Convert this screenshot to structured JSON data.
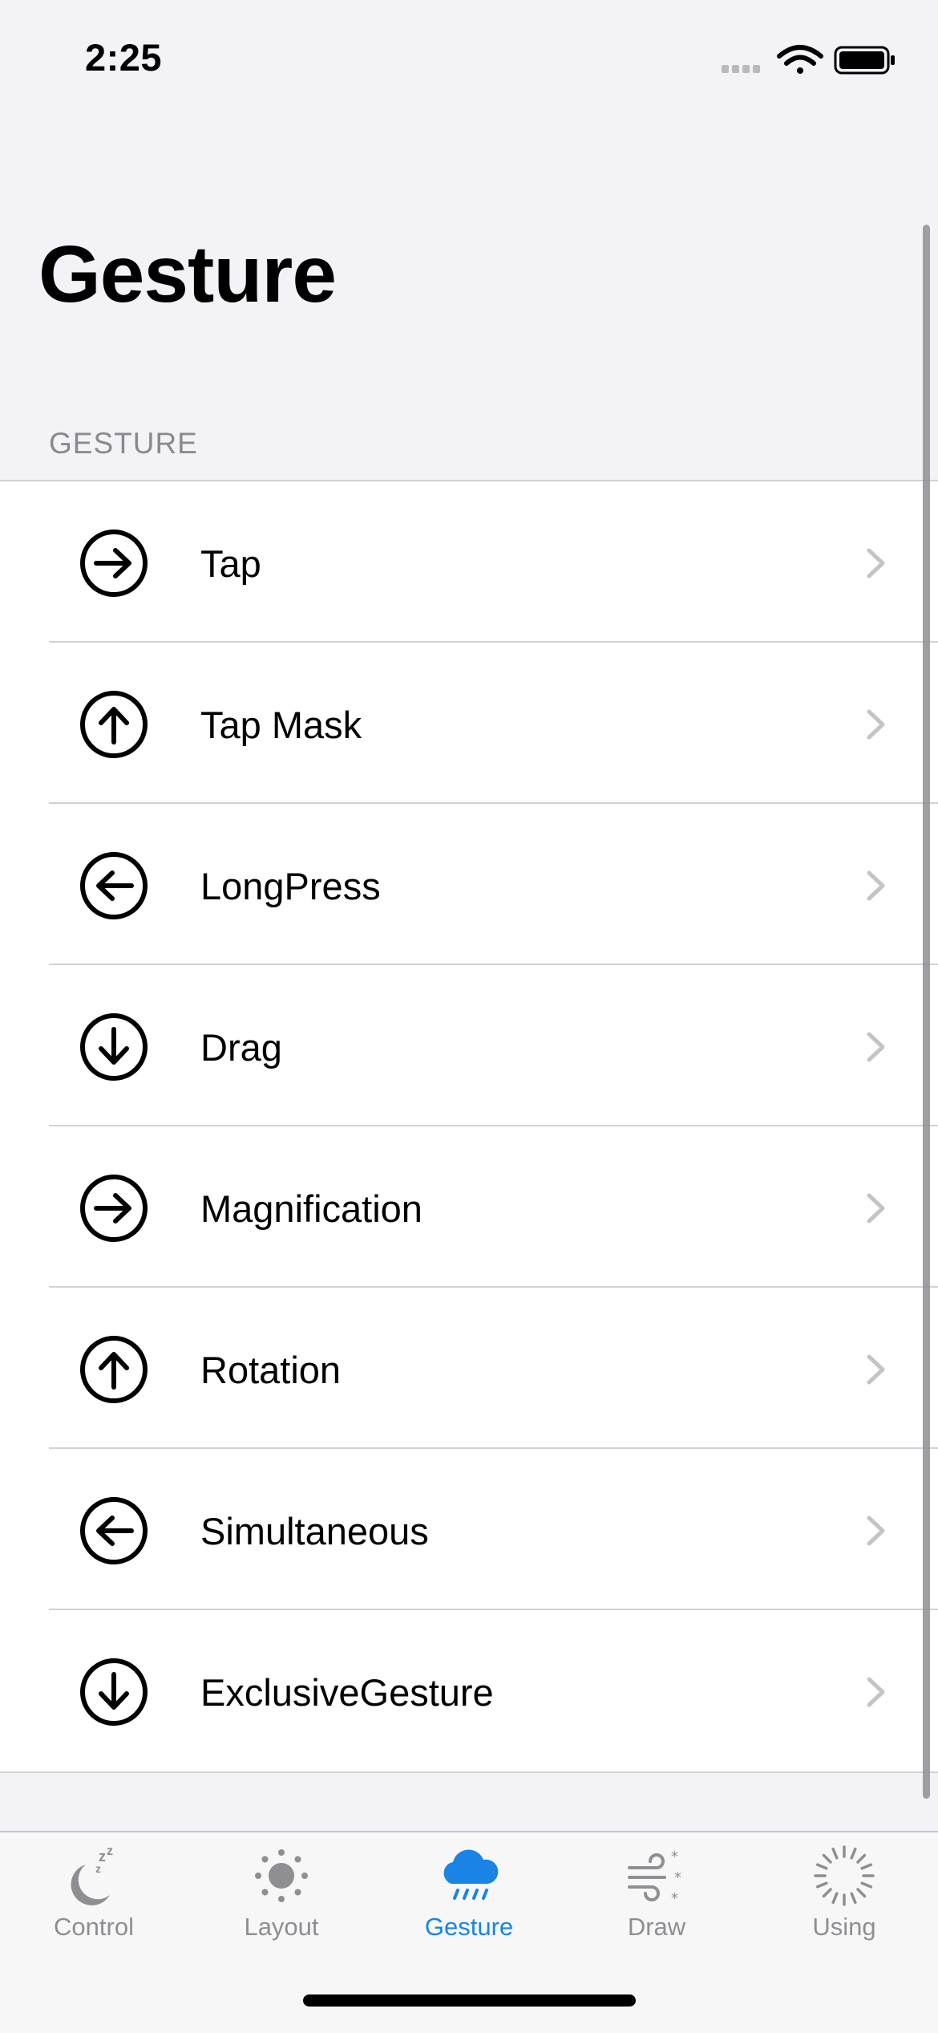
{
  "status_bar": {
    "time": "2:25",
    "icons": [
      "signal-icon",
      "wifi-icon",
      "battery-icon"
    ]
  },
  "nav": {
    "title": "Gesture"
  },
  "section": {
    "header": "GESTURE"
  },
  "rows": [
    {
      "label": "Tap",
      "icon": "arrow-right-circle-icon"
    },
    {
      "label": "Tap Mask",
      "icon": "arrow-up-circle-icon"
    },
    {
      "label": "LongPress",
      "icon": "arrow-left-circle-icon"
    },
    {
      "label": "Drag",
      "icon": "arrow-down-circle-icon"
    },
    {
      "label": "Magnification",
      "icon": "arrow-right-circle-icon"
    },
    {
      "label": "Rotation",
      "icon": "arrow-up-circle-icon"
    },
    {
      "label": "Simultaneous",
      "icon": "arrow-left-circle-icon"
    },
    {
      "label": "ExclusiveGesture",
      "icon": "arrow-down-circle-icon"
    }
  ],
  "tabs": [
    {
      "label": "Control",
      "icon": "moon-zzz-icon",
      "active": false
    },
    {
      "label": "Layout",
      "icon": "sun-icon",
      "active": false
    },
    {
      "label": "Gesture",
      "icon": "cloud-rain-icon",
      "active": true
    },
    {
      "label": "Draw",
      "icon": "wind-snow-icon",
      "active": false
    },
    {
      "label": "Using",
      "icon": "activity-spinner-icon",
      "active": false
    }
  ],
  "colors": {
    "accent": "#1a84e6",
    "inactive": "#8e8e93",
    "background": "#f2f2f7",
    "separator": "#d1d1d6"
  }
}
